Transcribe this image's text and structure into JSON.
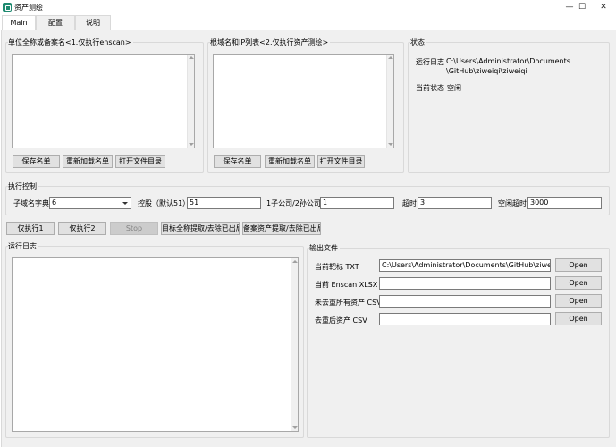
{
  "window": {
    "title": "资产测绘",
    "minimize": "—",
    "maximize": "☐",
    "close": "✕"
  },
  "tabs": [
    {
      "label": "Main",
      "active": true
    },
    {
      "label": "配置",
      "active": false
    },
    {
      "label": "说明",
      "active": false
    }
  ],
  "group_names": {
    "title": "单位全称或备案名<1.仅执行enscan>",
    "save": "保存名单",
    "reload": "重新加载名单",
    "open_dir": "打开文件目录"
  },
  "group_domains": {
    "title": "根域名和IP列表<2.仅执行资产测绘>",
    "save": "保存名单",
    "reload": "重新加载名单",
    "open_dir": "打开文件目录"
  },
  "group_status": {
    "title": "状态",
    "log_label": "运行日志",
    "log_path": "C:\\Users\\Administrator\\Documents\\GitHub\\ziweiqi\\ziweiqi",
    "state_label": "当前状态",
    "state_value": "空闲"
  },
  "group_exec": {
    "title": "执行控制",
    "dict_label": "子域名字典",
    "dict_value": "6",
    "holding_label": "控股（默认51）",
    "holding_value": "51",
    "sub_label": "1子公司/2孙公司",
    "sub_value": "1",
    "timeout_label": "超时",
    "timeout_value": "3",
    "idle_label": "空闲超时",
    "idle_value": "3000"
  },
  "actions": {
    "run1": "仅执行1",
    "run2": "仅执行2",
    "stop": "Stop",
    "extract_targets": "目标全称提取/去除已出局",
    "extract_assets": "备案资产提取/去除已出局"
  },
  "log": {
    "title": "运行日志"
  },
  "output": {
    "title": "输出文件",
    "rows": [
      {
        "label": "当前靶标 TXT",
        "value": "C:\\Users\\Administrator\\Documents\\GitHub\\ziweiqi\\ziwei",
        "button": "Open"
      },
      {
        "label": "当前 Enscan XLSX",
        "value": "",
        "button": "Open"
      },
      {
        "label": "未去重所有资产 CSV",
        "value": "",
        "button": "Open"
      },
      {
        "label": "去重后资产 CSV",
        "value": "",
        "button": "Open"
      }
    ]
  },
  "colors": {
    "accent": "#1f8a70",
    "background": "#f0f0f0",
    "button": "#e1e1e1",
    "button_border": "#adadad"
  }
}
